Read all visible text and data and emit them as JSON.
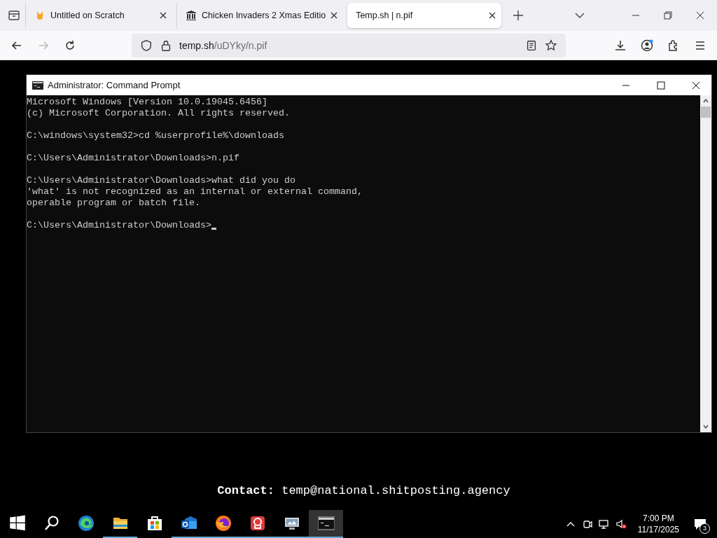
{
  "browser": {
    "tabs": [
      {
        "title": "Untitled on Scratch",
        "kind": "scratch",
        "selected": false
      },
      {
        "title": "Chicken Invaders 2 Xmas Editio",
        "kind": "building",
        "selected": false
      },
      {
        "title": "Temp.sh | n.pif",
        "kind": "none",
        "selected": true
      }
    ],
    "address": {
      "host": "temp.sh",
      "path": "/uDYky/n.pif"
    }
  },
  "console_window": {
    "title": "Administrator: Command Prompt",
    "blocks": [
      [
        "Microsoft Windows [Version 10.0.19045.6456]",
        "(c) Microsoft Corporation. All rights reserved."
      ],
      [
        "C:\\windows\\system32>cd %userprofile%\\downloads"
      ],
      [
        "C:\\Users\\Administrator\\Downloads>n.pif"
      ],
      [
        "C:\\Users\\Administrator\\Downloads>what did you do",
        "'what' is not recognized as an internal or external command,",
        "operable program or batch file."
      ],
      [
        "C:\\Users\\Administrator\\Downloads>"
      ]
    ],
    "cursor": true
  },
  "contact": "**Contact:** temp@national.shitposting.agency",
  "taskbar": {
    "apps": [
      {
        "kind": "start",
        "running": false,
        "selected": false
      },
      {
        "kind": "search",
        "running": false,
        "selected": false
      },
      {
        "kind": "edge",
        "running": false,
        "selected": false
      },
      {
        "kind": "folder",
        "running": true,
        "selected": false
      },
      {
        "kind": "store",
        "running": false,
        "selected": false
      },
      {
        "kind": "mail",
        "running": true,
        "selected": false
      },
      {
        "kind": "firefox",
        "running": true,
        "selected": false
      },
      {
        "kind": "red",
        "running": true,
        "selected": false
      },
      {
        "kind": "monitor",
        "running": true,
        "selected": false
      },
      {
        "kind": "console",
        "running": true,
        "selected": true
      }
    ],
    "time": "7:00 PM",
    "date": "11/17/2025",
    "notifications": "3"
  }
}
